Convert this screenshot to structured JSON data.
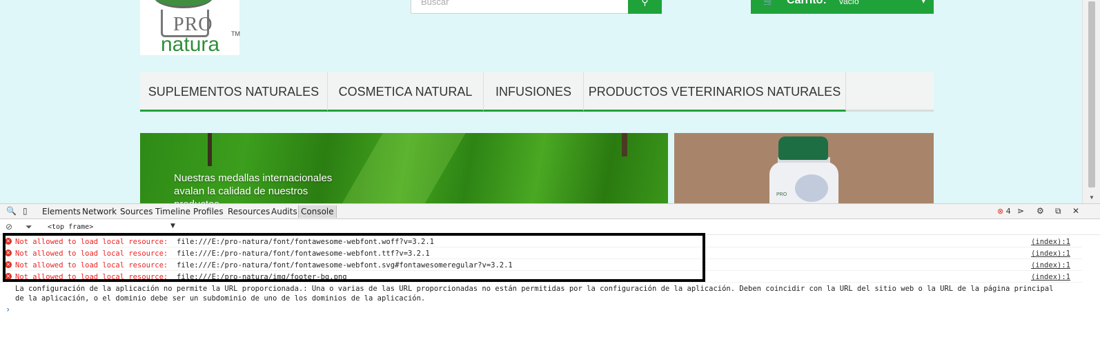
{
  "site": {
    "logo": {
      "line1": "PRO",
      "line2": "natura",
      "tm": "TM"
    },
    "search": {
      "placeholder": "Buscar",
      "button_icon": "search-icon"
    },
    "cart": {
      "icon": "cart-icon",
      "label": "Carrito:",
      "state": "vacío"
    },
    "nav": {
      "items": [
        {
          "label": "SUPLEMENTOS NATURALES"
        },
        {
          "label": "COSMETICA NATURAL"
        },
        {
          "label": "INFUSIONES"
        },
        {
          "label": "PRODUCTOS VETERINARIOS NATURALES"
        }
      ]
    },
    "banner": {
      "text": "Nuestras medallas internacionales avalan la calidad de nuestros productos"
    },
    "product": {
      "brand": "PRO"
    }
  },
  "devtools": {
    "tabs": [
      "Elements",
      "Network",
      "Sources",
      "Timeline",
      "Profiles",
      "Resources",
      "Audits",
      "Console"
    ],
    "active_tab": "Console",
    "error_count": "4",
    "context": "<top frame>",
    "messages": [
      {
        "text": "Not allowed to load local resource:",
        "url": "file:///E:/pro-natura/font/fontawesome-webfont.woff?v=3.2.1",
        "source": "(index):1"
      },
      {
        "text": "Not allowed to load local resource:",
        "url": "file:///E:/pro-natura/font/fontawesome-webfont.ttf?v=3.2.1",
        "source": "(index):1"
      },
      {
        "text": "Not allowed to load local resource:",
        "url": "file:///E:/pro-natura/font/fontawesome-webfont.svg#fontawesomeregular?v=3.2.1",
        "source": "(index):1"
      },
      {
        "text": "Not allowed to load local resource:",
        "url": "file:///E:/pro-natura/img/footer-bg.png",
        "source": "(index):1"
      }
    ],
    "log": "La configuración de la aplicación no permite la URL proporcionada.: Una o varias de las URL proporcionadas no están permitidas por la configuración de la aplicación. Deben coincidir con la URL del sitio web o la URL de la página principal de la aplicación, o el dominio debe ser un subdominio de uno de los dominios de la aplicación.",
    "prompt": "›"
  }
}
